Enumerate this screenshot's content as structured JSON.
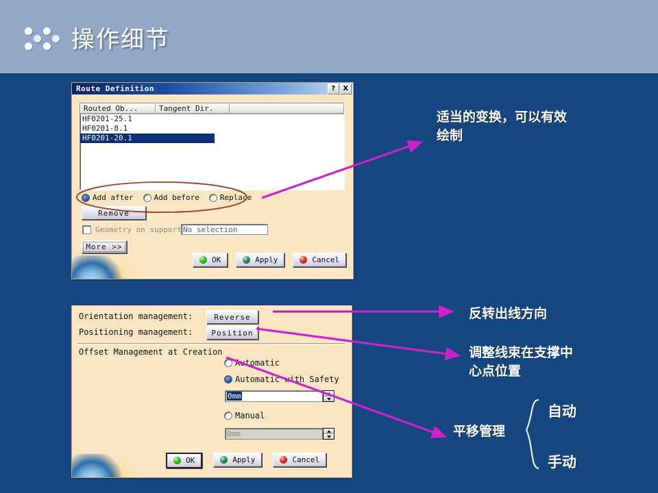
{
  "slide": {
    "title": "操作细节",
    "background_color": "#154680",
    "header_color": "#92a8c6",
    "accent_arrow_color": "#cc22cc",
    "ellipse_color": "#a33a2a"
  },
  "dialog1": {
    "title": "Route Definition",
    "help_button": "?",
    "close_button": "X",
    "list": {
      "columns": [
        "Routed Ob...",
        "Tangent Dir."
      ],
      "rows": [
        "HF0201-25.1",
        "HF0201-8.1",
        "HF0201-20.1"
      ],
      "selected_row": "HF0201-20.1"
    },
    "radios": [
      {
        "label": "Add after",
        "selected": true
      },
      {
        "label": "Add before",
        "selected": false
      },
      {
        "label": "Replace",
        "selected": false
      }
    ],
    "remove_button": "Remove",
    "geometry_checkbox": "Geometry on support",
    "geometry_value": "No selection",
    "more_button": "More >>",
    "buttons": [
      {
        "label": "OK",
        "ball": "green"
      },
      {
        "label": "Apply",
        "ball": "teal"
      },
      {
        "label": "Cancel",
        "ball": "red"
      }
    ]
  },
  "dialog2": {
    "orientation_label": "Orientation management:",
    "orientation_button": "Reverse",
    "positioning_label": "Positioning management:",
    "positioning_button": "Position",
    "offset_section": "Offset Management at Creation",
    "radios": [
      {
        "label": "Automatic",
        "selected": false
      },
      {
        "label": "Automatic with Safety",
        "selected": true
      },
      {
        "label": "Manual",
        "selected": false
      }
    ],
    "safety_value": "0mm",
    "manual_value": "0mm",
    "buttons": [
      {
        "label": "OK",
        "ball": "green"
      },
      {
        "label": "Apply",
        "ball": "teal"
      },
      {
        "label": "Cancel",
        "ball": "red"
      }
    ]
  },
  "annotations": {
    "note1": "适当的变换，可以有效\n绘制",
    "note2": "反转出线方向",
    "note3": "调整线束在支撑中\n心点位置",
    "note4": "平移管理",
    "brace_top": "自动",
    "brace_bottom": "手动"
  }
}
